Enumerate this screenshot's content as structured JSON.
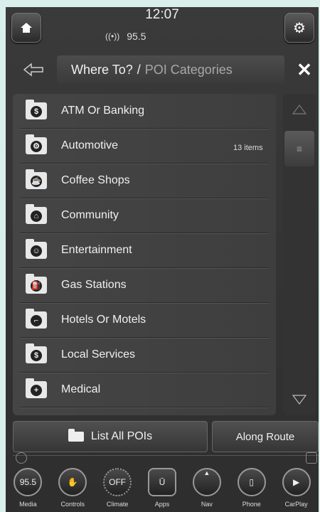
{
  "status": {
    "time": "12:07",
    "radio": "95.5"
  },
  "header": {
    "title_main": "Where To?",
    "title_sep": "/",
    "title_sub": "POI Categories"
  },
  "categories": [
    {
      "label": "ATM Or Banking",
      "icon": "dollar-icon",
      "glyph": "$"
    },
    {
      "label": "Automotive",
      "icon": "car-icon",
      "glyph": "⚙"
    },
    {
      "label": "Coffee Shops",
      "icon": "coffee-icon",
      "glyph": "☕"
    },
    {
      "label": "Community",
      "icon": "community-icon",
      "glyph": "⌂"
    },
    {
      "label": "Entertainment",
      "icon": "entertainment-icon",
      "glyph": "☺"
    },
    {
      "label": "Gas Stations",
      "icon": "gas-icon",
      "glyph": "⛽"
    },
    {
      "label": "Hotels Or Motels",
      "icon": "hotel-icon",
      "glyph": "⌐"
    },
    {
      "label": "Local Services",
      "icon": "services-icon",
      "glyph": "$"
    },
    {
      "label": "Medical",
      "icon": "medical-icon",
      "glyph": "+"
    }
  ],
  "items_count": "13 items",
  "buttons": {
    "list_all": "List All POIs",
    "along_route": "Along Route"
  },
  "dock": [
    {
      "label": "Media",
      "value": "95.5"
    },
    {
      "label": "Controls",
      "value": "✋"
    },
    {
      "label": "Climate",
      "value": "OFF"
    },
    {
      "label": "Apps",
      "value": "Ū"
    },
    {
      "label": "Nav",
      "value": "▲"
    },
    {
      "label": "Phone",
      "value": "▯"
    },
    {
      "label": "CarPlay",
      "value": "▶"
    }
  ]
}
